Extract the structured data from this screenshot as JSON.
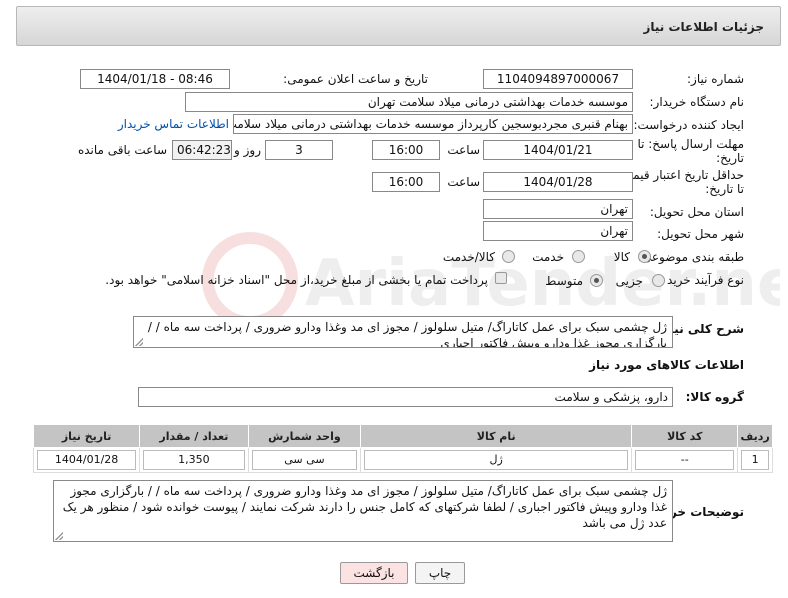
{
  "panel": {
    "title": "جزئیات اطلاعات نیاز"
  },
  "form": {
    "need_number": {
      "label": "شماره نیاز:",
      "value": "1104094897000067"
    },
    "announce_datetime": {
      "label": "تاریخ و ساعت اعلان عمومی:",
      "value": "1404/01/18 - 08:46"
    },
    "buyer_org": {
      "label": "نام دستگاه خریدار:",
      "value": "موسسه خدمات بهداشتی درمانی میلاد سلامت تهران"
    },
    "requester": {
      "label": "ایجاد کننده درخواست:",
      "value": "بهنام قنبری مجردبوسجین کارپرداز موسسه خدمات بهداشتی درمانی میلاد سلامت",
      "contact_link": "اطلاعات تماس خریدار"
    },
    "response_deadline": {
      "label_line1": "مهلت ارسال پاسخ: تا",
      "label_line2": "تاریخ:",
      "date": "1404/01/21",
      "time_label": "ساعت",
      "time": "16:00",
      "days": "3",
      "days_label": "روز و",
      "remaining": "06:42:23",
      "remaining_label": "ساعت باقی مانده"
    },
    "price_validity": {
      "label_line1": "حداقل تاریخ اعتبار قیمت:",
      "label_line2": "تا تاریخ:",
      "date": "1404/01/28",
      "time_label": "ساعت",
      "time": "16:00"
    },
    "delivery_province": {
      "label": "استان محل تحویل:",
      "value": "تهران"
    },
    "delivery_city": {
      "label": "شهر محل تحویل:",
      "value": "تهران"
    },
    "category": {
      "label": "طبقه بندی موضوعی:",
      "options": [
        "کالا",
        "خدمت",
        "کالا/خدمت"
      ],
      "selected": "کالا"
    },
    "purchase_process": {
      "label": "نوع فرآیند خرید :",
      "options": [
        "جزیی",
        "متوسط"
      ],
      "selected": "متوسط",
      "payment_note": "پرداخت تمام یا بخشی از مبلغ خرید،از محل \"اسناد خزانه اسلامی\" خواهد بود."
    }
  },
  "general_description": {
    "label": "شرح کلی نیاز:",
    "text": "ژل چشمی سبک برای عمل کاتاراگ/ متیل سلولوز  / مجوز ای مد  وغذا ودارو ضروری / پرداخت سه ماه / / بارگزاری مجوز غذا ودارو وپیش فاکتور اجباری"
  },
  "goods_info": {
    "title": "اطلاعات کالاهای مورد نیاز"
  },
  "goods_group": {
    "label": "گروه کالا:",
    "value": "دارو، پزشکی و سلامت"
  },
  "table": {
    "headers": [
      "ردیف",
      "کد کالا",
      "نام کالا",
      "واحد شمارش",
      "تعداد / مقدار",
      "تاریخ نیاز"
    ],
    "rows": [
      {
        "row": "1",
        "code": "--",
        "name": "ژل",
        "unit": "سی سی",
        "qty": "1,350",
        "date": "1404/01/28"
      }
    ]
  },
  "buyer_notes": {
    "label": "توضیحات خریدار:",
    "text": "ژل چشمی سبک برای عمل کاتاراگ/ متیل سلولوز  / مجوز ای مد  وغذا ودارو ضروری / پرداخت سه ماه / / بارگزاری مجوز غذا ودارو وپیش فاکتور اجباری  / لطفا شرکتهای که کامل جنس را دارند شرکت نمایند / پیوست خوانده شود / منظور هر یک عدد ژل می باشد"
  },
  "buttons": {
    "print": "چاپ",
    "back": "بازگشت"
  },
  "watermark": {
    "text": "AriaTender.net"
  },
  "colors": {
    "link": "#0050aa",
    "back_button_bg": "#fbe3e3",
    "header_gray": "#c4c4c4"
  }
}
